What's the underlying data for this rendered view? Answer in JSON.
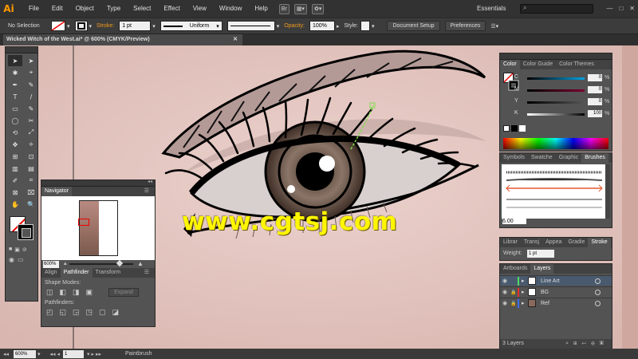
{
  "app": {
    "logo": "Ai",
    "workspace": "Essentials"
  },
  "menu": [
    "File",
    "Edit",
    "Object",
    "Type",
    "Select",
    "Effect",
    "View",
    "Window",
    "Help"
  ],
  "menubar_icons": {
    "bridge": "Br",
    "arrange": "▦▾",
    "brush": "✿▾"
  },
  "window_controls": [
    "—",
    "□",
    "✕"
  ],
  "control": {
    "selection": "No Selection",
    "stroke_label": "Stroke:",
    "stroke_weight": "1 pt",
    "profile": "Uniform",
    "opacity_label": "Opacity:",
    "opacity": "100%",
    "style_label": "Style:",
    "doc_setup": "Document Setup",
    "preferences": "Preferences"
  },
  "document": {
    "tab": "Wicked Witch of the West.ai* @ 600% (CMYK/Preview)",
    "close": "✕"
  },
  "watermark": "www.cgtsj.com",
  "tools": [
    "➤",
    "➤",
    "✱",
    "⌖",
    "✒",
    "✎",
    "T",
    "/",
    "▭",
    "✎",
    "◯",
    "✂",
    "⟲",
    "⤢",
    "✥",
    "⟡",
    "⊞",
    "⊡",
    "▥",
    "▤",
    "✐",
    "⌗",
    "⊠",
    "⌧",
    "✋",
    "🔍"
  ],
  "navigator": {
    "tab": "Navigator",
    "zoom": "600%",
    "tabs": [
      "Align",
      "Pathfinder",
      "Transform"
    ],
    "shape_modes_label": "Shape Modes:",
    "pathfinders_label": "Pathfinders:",
    "expand": "Expand"
  },
  "color_panel": {
    "tabs": [
      "Color",
      "Color Guide",
      "Color Themes"
    ],
    "rows": [
      {
        "label": "C",
        "value": "0"
      },
      {
        "label": "M",
        "value": "0"
      },
      {
        "label": "Y",
        "value": "0"
      },
      {
        "label": "K",
        "value": "100"
      }
    ],
    "pct": "%"
  },
  "brush_panel": {
    "tabs": [
      "Symbols",
      "Swatche",
      "Graphic",
      "Brushes"
    ],
    "size": "6.00"
  },
  "stroke_panel": {
    "tabs": [
      "Librar",
      "Transj",
      "Appea",
      "Gradie",
      "Stroke"
    ],
    "weight_label": "Weight:",
    "weight": "1 pt"
  },
  "layers_panel": {
    "tabs": [
      "Artboards",
      "Layers"
    ],
    "layers": [
      {
        "name": "Line Art",
        "color": "#4cd964"
      },
      {
        "name": "BG",
        "color": "#e03030"
      },
      {
        "name": "Ref",
        "color": "#3b6cff"
      }
    ],
    "footer": "3 Layers"
  },
  "status": {
    "zoom": "600%",
    "page": "1",
    "tool": "Paintbrush"
  }
}
